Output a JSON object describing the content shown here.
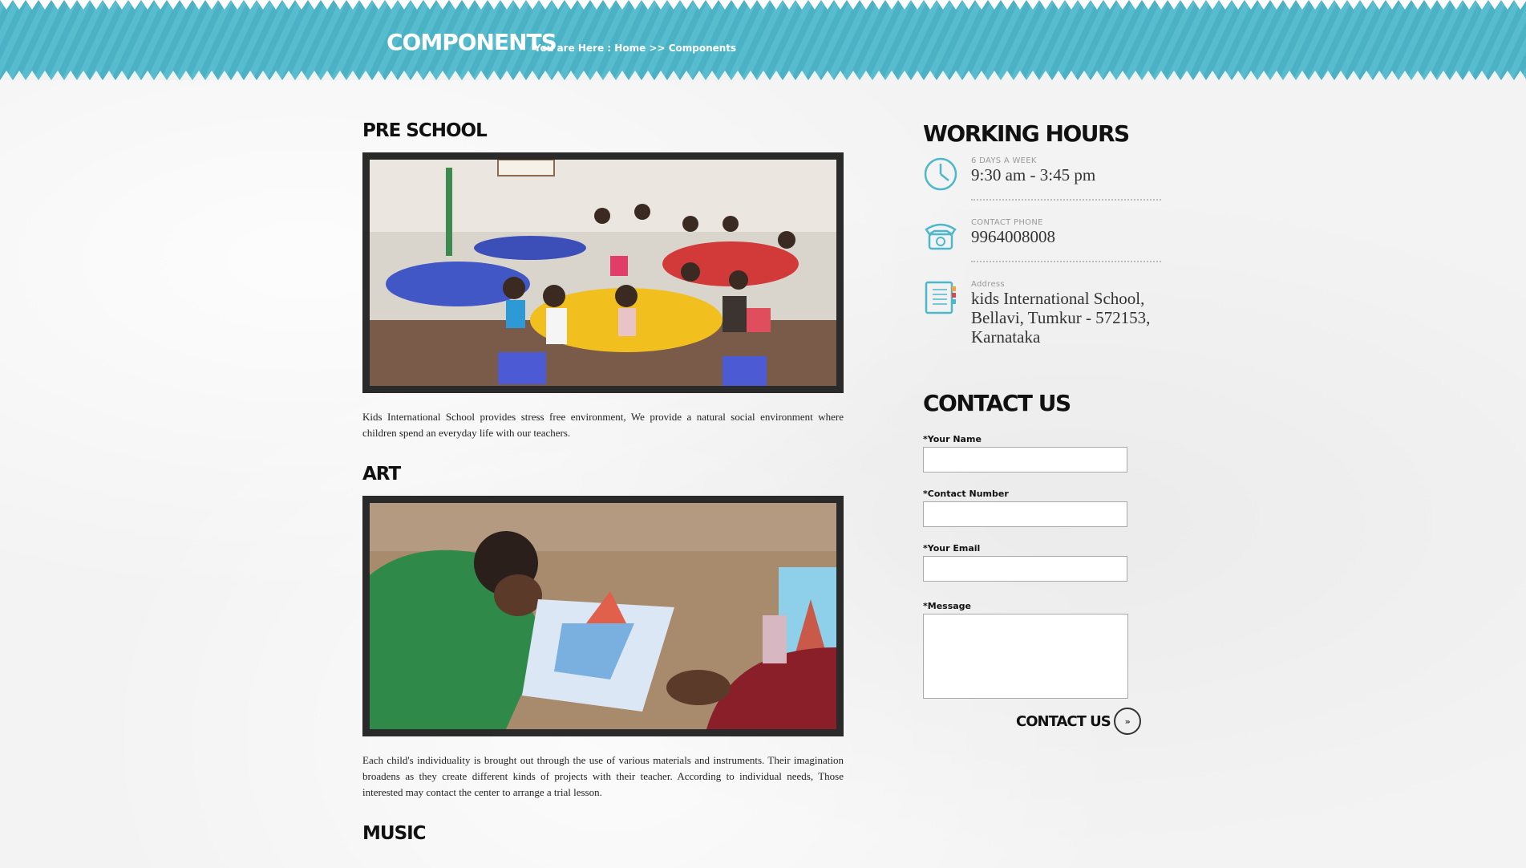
{
  "header": {
    "title": "COMPONENTS",
    "breadcrumb_prefix": "You are Here : ",
    "breadcrumb_home": "Home",
    "breadcrumb_sep": " >> ",
    "breadcrumb_current": "Components"
  },
  "sections": [
    {
      "heading": "PRE SCHOOL",
      "description": "Kids International School provides stress free environment, We provide a natural social environment where children spend an everyday life with our teachers."
    },
    {
      "heading": "ART",
      "description": "Each child's individuality is brought out through the use of various materials and instruments. Their imagination broadens as they create different kinds of projects with their teacher. According to individual needs, Those interested may contact the center to arrange a trial lesson."
    },
    {
      "heading": "MUSIC"
    }
  ],
  "sidebar": {
    "working_hours_heading": "WORKING HOURS",
    "hours_label": "6 DAYS A WEEK",
    "hours_value": "9:30 am - 3:45 pm",
    "phone_label": "CONTACT PHONE",
    "phone_value": "9964008008",
    "address_label": "Address",
    "address_value": "kids International School, Bellavi, Tumkur - 572153, Karnataka",
    "contact_heading": "CONTACT US",
    "form": {
      "name_label": "*Your Name",
      "number_label": "*Contact Number",
      "email_label": "*Your Email",
      "message_label": "*Message",
      "submit_label": "CONTACT US",
      "submit_glyph": "»"
    }
  },
  "colors": {
    "header_bg": "#4db8cb",
    "icon_accent": "#4db8cb",
    "photo_frame": "#2a2a2a"
  },
  "icons": [
    "clock-icon",
    "phone-icon",
    "address-book-icon",
    "arrow-circle-icon"
  ]
}
